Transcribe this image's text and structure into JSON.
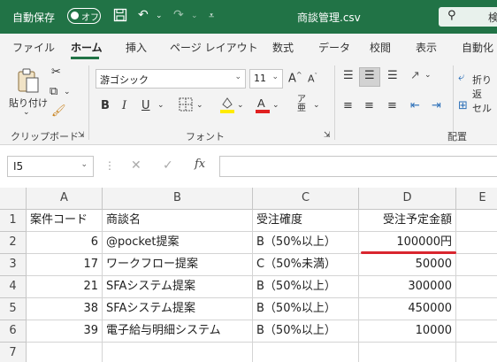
{
  "titlebar": {
    "autosave_label": "自動保存",
    "toggle_label": "オフ",
    "filename": "商談管理.csv",
    "search_placeholder": "検"
  },
  "ribbon_tabs": [
    "ファイル",
    "ホーム",
    "挿入",
    "ページ レイアウト",
    "数式",
    "データ",
    "校閲",
    "表示",
    "自動化"
  ],
  "active_tab": "ホーム",
  "ribbon": {
    "clipboard": {
      "paste_label": "貼り付け",
      "group_label": "クリップボード"
    },
    "font": {
      "font_name": "游ゴシック",
      "font_size": "11",
      "bold": "B",
      "italic": "I",
      "underline": "U",
      "group_label": "フォント"
    },
    "alignment": {
      "wrap_label": "折り返",
      "merge_label": "セル",
      "group_label": "配置"
    }
  },
  "formula_bar": {
    "name_box": "I5",
    "fx": "fx",
    "value": ""
  },
  "grid": {
    "columns": [
      "A",
      "B",
      "C",
      "D",
      "E"
    ],
    "rows": [
      {
        "num": "1",
        "a": "案件コード",
        "b": "商談名",
        "c": "受注確度",
        "d": "受注予定金額",
        "e": ""
      },
      {
        "num": "2",
        "a": "6",
        "b": "@pocket提案",
        "c": "B（50%以上）",
        "d": "100000円",
        "e": ""
      },
      {
        "num": "3",
        "a": "17",
        "b": "ワークフロー提案",
        "c": "C（50%未満）",
        "d": "50000",
        "e": ""
      },
      {
        "num": "4",
        "a": "21",
        "b": "SFAシステム提案",
        "c": "B（50%以上）",
        "d": "300000",
        "e": ""
      },
      {
        "num": "5",
        "a": "38",
        "b": "SFAシステム提案",
        "c": "B（50%以上）",
        "d": "450000",
        "e": ""
      },
      {
        "num": "6",
        "a": "39",
        "b": "電子給与明細システム",
        "c": "B（50%以上）",
        "d": "10000",
        "e": ""
      },
      {
        "num": "7",
        "a": "",
        "b": "",
        "c": "",
        "d": "",
        "e": ""
      }
    ]
  },
  "colors": {
    "excel_green": "#217346",
    "highlight_red": "#d9262f",
    "font_color_red": "#e02020",
    "highlight_yellow": "#ffeb00"
  }
}
